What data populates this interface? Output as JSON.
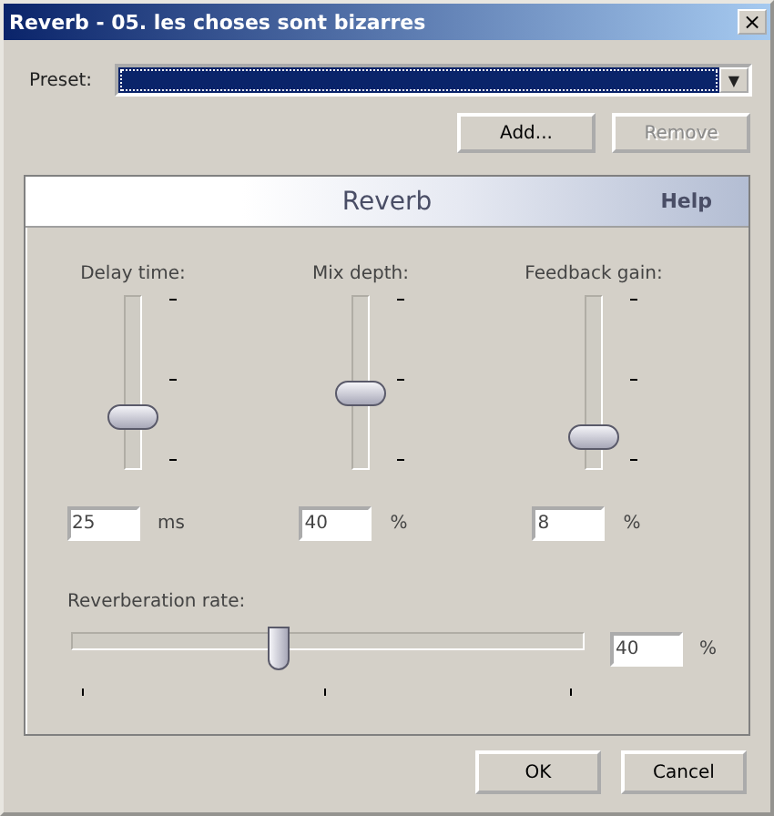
{
  "window": {
    "title": "Reverb - 05. les choses sont bizarres",
    "close": "×"
  },
  "preset": {
    "label": "Preset:",
    "arrow": "▼"
  },
  "preset_buttons": [
    {
      "label": "Add...",
      "disabled": false
    },
    {
      "label": "Remove",
      "disabled": true
    }
  ],
  "panel": {
    "title": "Reverb",
    "help": "Help"
  },
  "vertical_sliders": [
    {
      "label": "Delay time:",
      "level": 0.27,
      "value": "25",
      "unit": "ms"
    },
    {
      "label": "Mix depth:",
      "level": 0.43,
      "value": "40",
      "unit": "%"
    },
    {
      "label": "Feedback gain:",
      "level": 0.13,
      "value": "8",
      "unit": "%"
    }
  ],
  "reverberation_rate": {
    "label": "Reverberation rate:",
    "level": 0.4,
    "value": "40",
    "unit": "%"
  },
  "buttons": [
    {
      "label": "OK",
      "disabled": false
    },
    {
      "label": "Cancel",
      "disabled": false
    }
  ]
}
